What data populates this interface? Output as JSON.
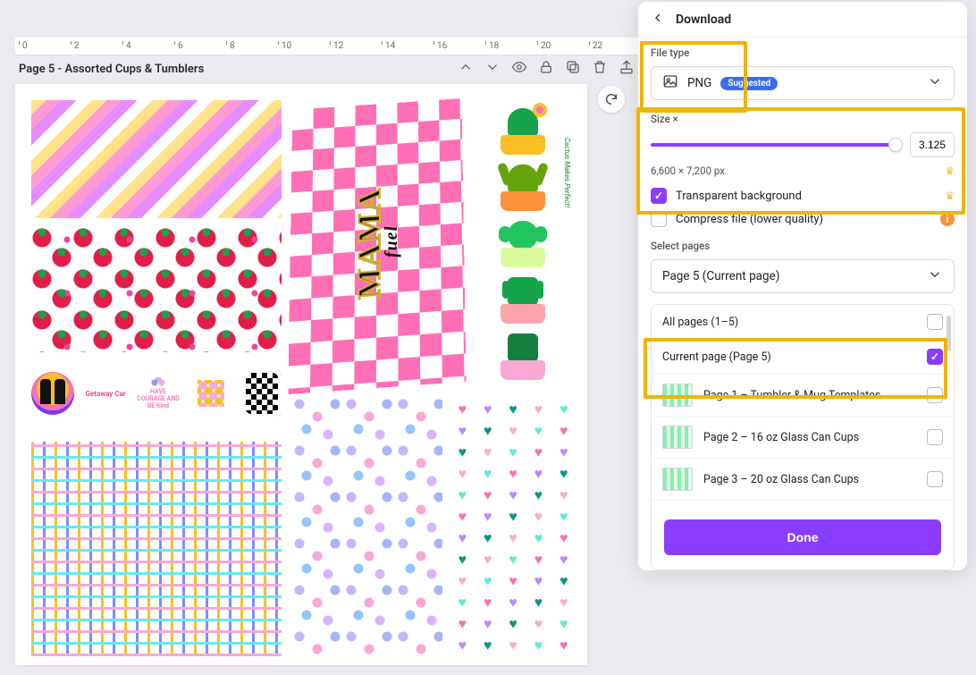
{
  "canvas": {
    "page_title": "Page 5 - Assorted Cups & Tumblers",
    "ruler_ticks": [
      "0",
      "2",
      "4",
      "6",
      "8",
      "10",
      "12",
      "14",
      "16",
      "18",
      "20",
      "22"
    ],
    "art": {
      "mama_text": "MAMA",
      "mama_sub": "fuel",
      "badge2": "Getaway Car",
      "badge3": "HAVE COURAGE AND BE Kind",
      "cactus_caption": "Cactus Makes Perfect!"
    }
  },
  "panel": {
    "title": "Download",
    "file_type": {
      "label": "File type",
      "value": "PNG",
      "badge": "Suggested"
    },
    "size": {
      "label": "Size ×",
      "value": "3.125",
      "dimensions": "6,600 × 7,200 px"
    },
    "options": {
      "transparent": "Transparent background",
      "compress": "Compress file (lower quality)"
    },
    "select_pages": {
      "label": "Select pages",
      "selected": "Page 5 (Current page)",
      "items": [
        {
          "label": "All pages (1–5)",
          "checked": false,
          "thumb": false
        },
        {
          "label": "Current page (Page 5)",
          "checked": true,
          "thumb": false
        },
        {
          "label": "Page 1 – Tumbler & Mug Templates",
          "checked": false,
          "thumb": true
        },
        {
          "label": "Page 2 – 16 oz Glass Can Cups",
          "checked": false,
          "thumb": true
        },
        {
          "label": "Page 3 – 20 oz Glass Can Cups",
          "checked": false,
          "thumb": true
        }
      ]
    },
    "done": "Done"
  }
}
